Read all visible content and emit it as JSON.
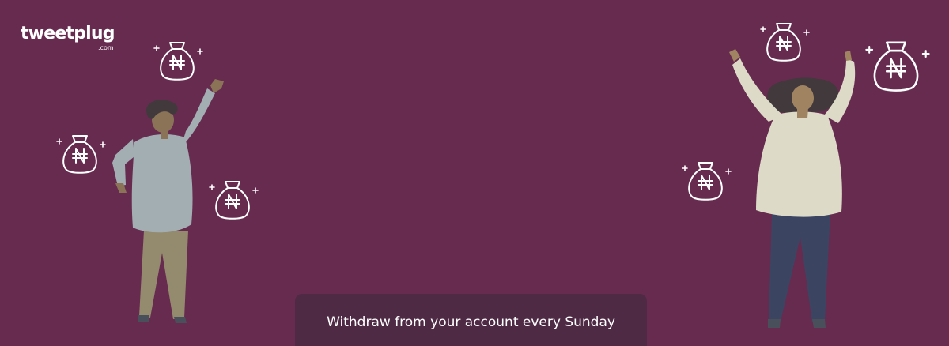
{
  "brand": {
    "name": "tweetplug",
    "domain": ".com"
  },
  "banner": {
    "caption": "Withdraw from your account every Sunday",
    "background": "#672b50",
    "caption_background": "#4f2a45"
  },
  "icons": {
    "money_bag": "money-bag-naira-icon"
  }
}
